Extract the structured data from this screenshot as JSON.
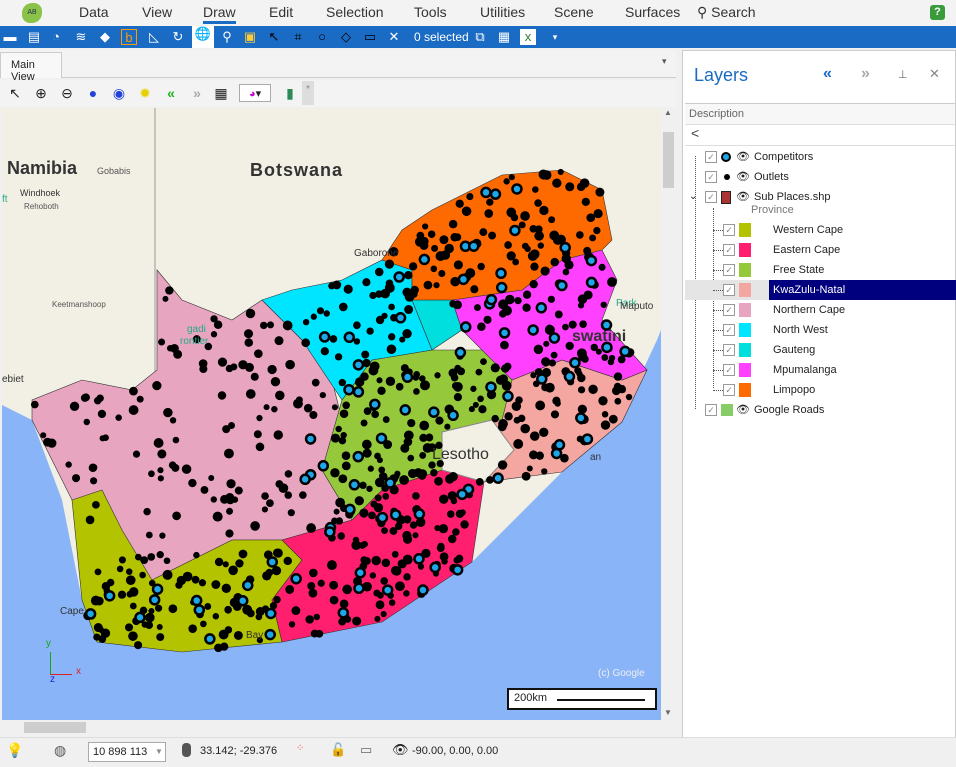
{
  "menu": {
    "items": [
      "Data",
      "View",
      "Draw",
      "Edit",
      "Selection",
      "Tools",
      "Utilities",
      "Scene",
      "Surfaces"
    ],
    "active": "Draw",
    "search": "Search",
    "help": "?"
  },
  "toolbar": {
    "selected_label": "0 selected"
  },
  "tabs": {
    "main": "Main View",
    "pin": "*"
  },
  "map": {
    "labels": {
      "namibia": "Namibia",
      "gobabis": "Gobabis",
      "windhoek": "Windhoek",
      "rehoboth": "Rehoboth",
      "botswana": "Botswana",
      "gaborone": "Gaborone",
      "keetmanshoop": "Keetmanshoop",
      "kgalagadi": "gadi",
      "transfrontier": "rontier",
      "maputo": "Maputo",
      "eswatini": "swatini",
      "park": "Park",
      "lesotho": "Lesotho",
      "cape": "Cape",
      "bay": "Bay",
      "ebiet": "ebiet",
      "ft": "ft",
      "an": "an"
    },
    "attribution": "(c) Google",
    "scale": "200km",
    "axes": {
      "y": "y",
      "x": "x",
      "z": "z"
    },
    "province_colors": {
      "Western Cape": "#b3c300",
      "Eastern Cape": "#ff1f6e",
      "Free State": "#95c93b",
      "KwaZulu-Natal": "#f4a6a0",
      "Northern Cape": "#e8a5c0",
      "North West": "#00e5ff",
      "Gauteng": "#00dede",
      "Mpumalanga": "#ff40ff",
      "Limpopo": "#ff6a00"
    },
    "competitor_color": "#1ea7e8",
    "outlet_color": "#000000"
  },
  "layers": {
    "title": "Layers",
    "column": "Description",
    "back": "<",
    "items": [
      {
        "label": "Competitors",
        "icon": "competitor-dot-icon"
      },
      {
        "label": "Outlets",
        "icon": "outlet-dot-icon"
      },
      {
        "label": "Sub Places.shp",
        "icon": "polygon-icon"
      }
    ],
    "group_label": "Province",
    "provinces": [
      {
        "label": "Western Cape",
        "color": "#b3c300"
      },
      {
        "label": "Eastern Cape",
        "color": "#ff1f6e"
      },
      {
        "label": "Free State",
        "color": "#95c93b"
      },
      {
        "label": "KwaZulu-Natal",
        "color": "#f4a6a0",
        "selected": true
      },
      {
        "label": "Northern Cape",
        "color": "#e8a5c0"
      },
      {
        "label": "North West",
        "color": "#00e5ff"
      },
      {
        "label": "Gauteng",
        "color": "#00dede"
      },
      {
        "label": "Mpumalanga",
        "color": "#ff40ff"
      },
      {
        "label": "Limpopo",
        "color": "#ff6a00"
      }
    ],
    "google_roads": "Google Roads"
  },
  "status": {
    "scale_value": "10 898 113",
    "coords": "33.142; -29.376",
    "view": "-90.00, 0.00, 0.00"
  }
}
